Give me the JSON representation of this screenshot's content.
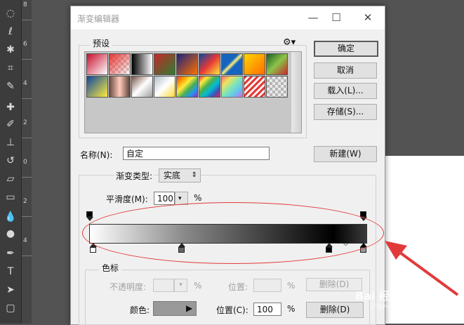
{
  "ruler": {
    "numbers": [
      "8",
      "6",
      "4",
      "2",
      "0",
      "2",
      "4"
    ]
  },
  "dialog": {
    "title": "渐变编辑器",
    "buttons": {
      "ok": "确定",
      "cancel": "取消",
      "load": "载入(L)...",
      "save": "存储(S)...",
      "new": "新建(W)"
    },
    "presets_label": "预设",
    "presets_gear": "⚙",
    "name_label": "名称(N):",
    "name_value": "自定",
    "gradient_type_label": "渐变类型:",
    "gradient_type_value": "实底",
    "smoothness_label": "平滑度(M):",
    "smoothness_value": "100",
    "smoothness_unit": "%",
    "color_stops": {
      "group_label": "色标",
      "opacity_label": "不透明度:",
      "opacity_unit": "%",
      "opacity_position_label": "位置:",
      "opacity_position_unit": "%",
      "opacity_delete": "删除(D)",
      "color_label": "颜色:",
      "color_value": "#999999",
      "color_position_label": "位置(C):",
      "color_position_value": "100",
      "color_position_unit": "%",
      "color_delete": "删除(D)"
    }
  },
  "gradient_stops": [
    0,
    0.33,
    0.88,
    1.0
  ],
  "watermark": {
    "brand": "Bai 经验",
    "sub": "jingyan.baidu.com"
  }
}
